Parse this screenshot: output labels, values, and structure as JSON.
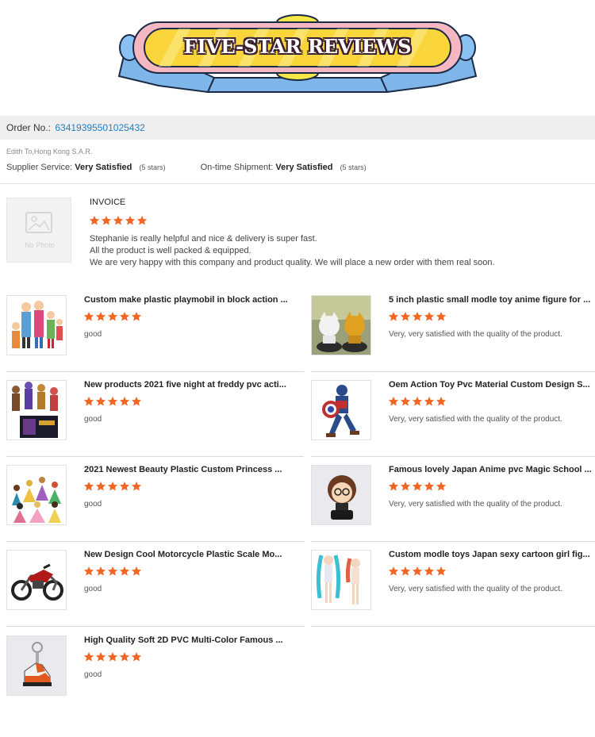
{
  "banner": {
    "title": "FIVE-STAR REVIEWS"
  },
  "order": {
    "label": "Order No.:",
    "number": "63419395501025432"
  },
  "buyer": {
    "location": "Edith To,Hong Kong S.A.R."
  },
  "ratings": {
    "supplier_label": "Supplier Service:",
    "supplier_value": "Very Satisfied",
    "supplier_stars": "(5 stars)",
    "shipment_label": "On-time Shipment:",
    "shipment_value": "Very Satisfied",
    "shipment_stars": "(5 stars)"
  },
  "invoice": {
    "no_photo": "No Photo",
    "title": "INVOICE",
    "rating": 5,
    "lines": [
      "Stephanie is really helpful and nice & delivery is super fast.",
      "All the product is well packed & equipped.",
      "We are very happy with this company and product quality. We will place a new order with them real soon."
    ]
  },
  "star_color": "#f26522",
  "products": [
    {
      "title": "Custom make plastic playmobil in block action ...",
      "comment": "good",
      "rating": 5,
      "icon": "playmobil-figures-image"
    },
    {
      "title": "5 inch plastic small modle toy anime figure for ...",
      "comment": "Very, very satisfied with the quality of the product.",
      "rating": 5,
      "icon": "anime-car-figures-image"
    },
    {
      "title": "New products 2021 five night at freddy pvc acti...",
      "comment": "good",
      "rating": 5,
      "icon": "freddy-figures-image"
    },
    {
      "title": "Oem Action Toy Pvc Material Custom Design S...",
      "comment": "Very, very satisfied with the quality of the product.",
      "rating": 5,
      "icon": "captain-figure-image"
    },
    {
      "title": "2021 Newest Beauty Plastic Custom Princess ...",
      "comment": "good",
      "rating": 5,
      "icon": "princess-figures-image"
    },
    {
      "title": "Famous lovely Japan Anime pvc Magic School ...",
      "comment": "Very, very satisfied with the quality of the product.",
      "rating": 5,
      "icon": "wizard-figure-image"
    },
    {
      "title": "New Design Cool Motorcycle Plastic Scale Mo...",
      "comment": "good",
      "rating": 5,
      "icon": "motorcycle-model-image"
    },
    {
      "title": "Custom modle toys Japan sexy cartoon girl fig...",
      "comment": "Very, very satisfied with the quality of the product.",
      "rating": 5,
      "icon": "anime-girl-figures-image"
    },
    {
      "title": "High Quality Soft 2D PVC Multi-Color Famous ...",
      "comment": "good",
      "rating": 5,
      "icon": "sneaker-keychain-image"
    }
  ]
}
